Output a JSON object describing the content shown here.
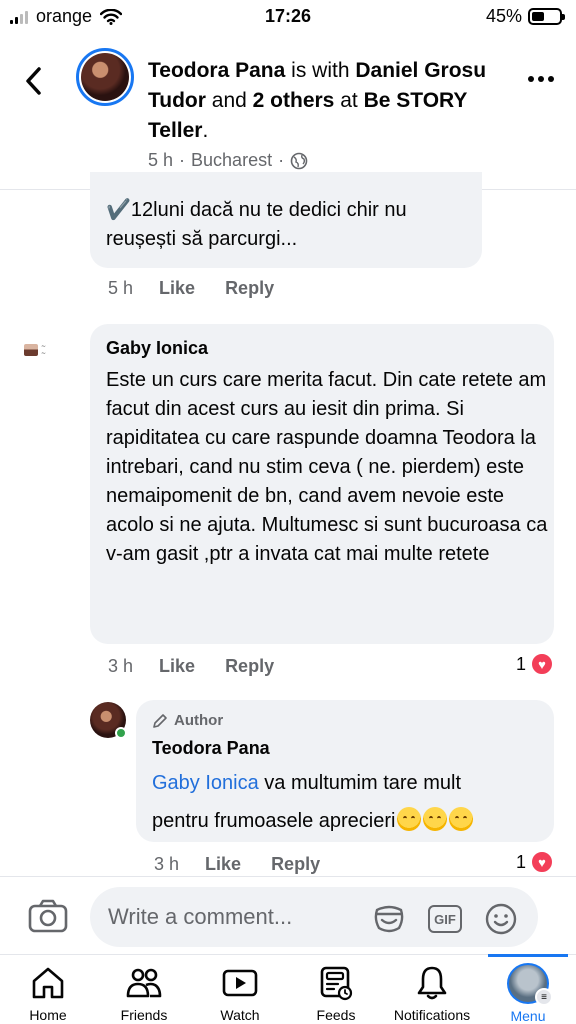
{
  "status_bar": {
    "carrier": "orange",
    "time": "17:26",
    "battery_percent": "45%",
    "battery_level": 0.45,
    "icons": [
      "signal-icon",
      "wifi-icon",
      "battery-icon"
    ]
  },
  "post_header": {
    "author": "Teodora Pana",
    "with_text": "is with",
    "tagged_person": "Daniel Grosu Tudor",
    "and_text": "and",
    "others": "2 others",
    "at_text": "at",
    "place": "Be STORY Teller",
    "period": ".",
    "time": "5 h",
    "separator": "·",
    "location": "Bucharest",
    "separator2": "·",
    "icons": [
      "back-icon",
      "globe-icon",
      "more-icon"
    ]
  },
  "comments": [
    {
      "text_line1": "✔️12luni dacă nu te dedici chir nu",
      "text_line2": "reușești să parcurgi...",
      "time": "5 h",
      "like_label": "Like",
      "reply_label": "Reply"
    },
    {
      "author": "Gaby Ionica",
      "text": "Este un curs care merita facut. Din cate retete am facut din acest curs au iesit din prima. Si rapiditatea cu care raspunde doamna Teodora la intrebari, cand nu stim ceva ( ne. pierdem) este nemaipomenit de bn, cand avem nevoie este acolo si ne ajuta. Multumesc si sunt bucuroasa ca v-am gasit ,ptr a invata cat mai multe retete",
      "time": "3 h",
      "like_label": "Like",
      "reply_label": "Reply",
      "reaction_count": "1"
    },
    {
      "badge": "Author",
      "author": "Teodora Pana",
      "mention": "Gaby Ionica",
      "text_after_mention": " va multumim tare mult",
      "text_line2": "pentru frumoasele aprecieri",
      "time": "3 h",
      "like_label": "Like",
      "reply_label": "Reply",
      "reaction_count": "1"
    }
  ],
  "composer": {
    "placeholder": "Write a comment...",
    "gif_label": "GIF"
  },
  "bottom_nav": {
    "items": [
      {
        "label": "Home",
        "icon": "home-icon"
      },
      {
        "label": "Friends",
        "icon": "friends-icon"
      },
      {
        "label": "Watch",
        "icon": "watch-icon"
      },
      {
        "label": "Feeds",
        "icon": "feeds-icon"
      },
      {
        "label": "Notifications",
        "icon": "bell-icon"
      },
      {
        "label": "Menu",
        "icon": "menu-avatar"
      }
    ],
    "active": "Menu"
  },
  "colors": {
    "accent": "#1877f2",
    "bubble": "#f0f2f5",
    "secondary_text": "#65676b",
    "heart": "#f33e58",
    "mention": "#216fdb",
    "online": "#31a24c"
  }
}
